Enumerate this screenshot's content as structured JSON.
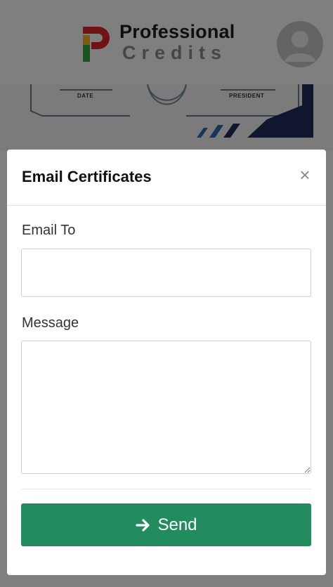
{
  "brand": {
    "name_line1": "Professional",
    "name_line2": "Credits",
    "colors": {
      "red": "#e0262b",
      "yellow": "#f3b61f",
      "green": "#3aa742"
    }
  },
  "header": {
    "avatar_icon": "user-avatar-icon"
  },
  "certificate": {
    "date_label": "DATE",
    "president_label": "PRESIDENT"
  },
  "modal": {
    "title": "Email Certificates",
    "close_label": "×",
    "email_label": "Email To",
    "email_value": "",
    "message_label": "Message",
    "message_value": "",
    "send_label": "Send",
    "send_icon": "arrow-right-icon",
    "accent_color": "#238c5f"
  }
}
